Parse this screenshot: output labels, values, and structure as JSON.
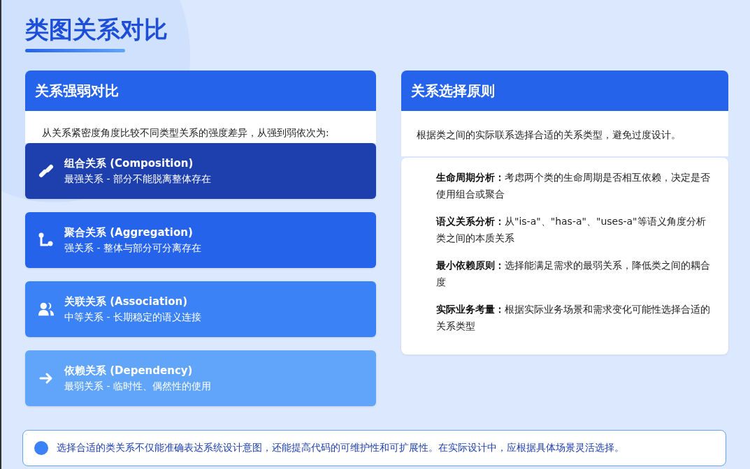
{
  "title": "类图关系对比",
  "strength_panel": {
    "title": "关系强弱对比",
    "intro": "从关系紧密度角度比较不同类型关系的强度差异，从强到弱依次为:",
    "items": [
      {
        "kind": "link",
        "color": "#1e40af",
        "name": "组合关系 (Composition)",
        "desc": "最强关系 - 部分不能脱离整体存在"
      },
      {
        "kind": "branch",
        "color": "#2563eb",
        "name": "聚合关系 (Aggregation)",
        "desc": "强关系 - 整体与部分可分离存在"
      },
      {
        "kind": "users",
        "color": "#3b82f6",
        "name": "关联关系 (Association)",
        "desc": "中等关系 - 长期稳定的语义连接"
      },
      {
        "kind": "arrow",
        "color": "#60a5fa",
        "name": "依赖关系 (Dependency)",
        "desc": "最弱关系 - 临时性、偶然性的使用"
      }
    ]
  },
  "principles_panel": {
    "title": "关系选择原则",
    "intro": "根据类之间的实际联系选择合适的关系类型，避免过度设计。",
    "principles": [
      "**生命周期分析：**考虑两个类的生命周期是否相互依赖，决定是否使用组合或聚合",
      "**语义关系分析：**从\"is-a\"、\"has-a\"、\"uses-a\"等语义角度分析类之间的本质关系",
      "**最小依赖原则：**选择能满足需求的最弱关系，降低类之间的耦合度",
      "**实际业务考量：**根据实际业务场景和需求变化可能性选择合适的关系类型"
    ]
  },
  "note": "选择合适的类关系不仅能准确表达系统设计意图，还能提高代码的可维护性和可扩展性。在实际设计中，应根据具体场景灵活选择。"
}
